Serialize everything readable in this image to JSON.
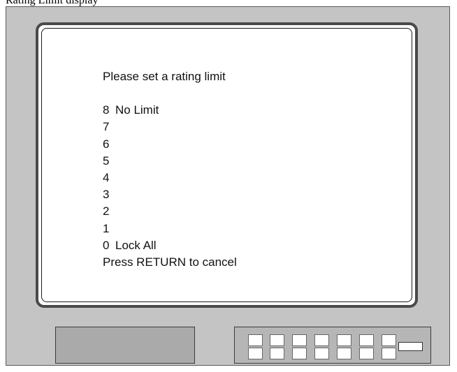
{
  "top_caption": "Rating Limit display",
  "screen": {
    "title": "Please set a rating limit",
    "options": [
      {
        "num": "8",
        "label": "No Limit"
      },
      {
        "num": "7",
        "label": ""
      },
      {
        "num": "6",
        "label": ""
      },
      {
        "num": "5",
        "label": ""
      },
      {
        "num": "4",
        "label": ""
      },
      {
        "num": "3",
        "label": ""
      },
      {
        "num": "2",
        "label": ""
      },
      {
        "num": "1",
        "label": ""
      },
      {
        "num": "0",
        "label": "Lock All"
      }
    ],
    "cancel_hint": "Press RETURN to cancel"
  }
}
